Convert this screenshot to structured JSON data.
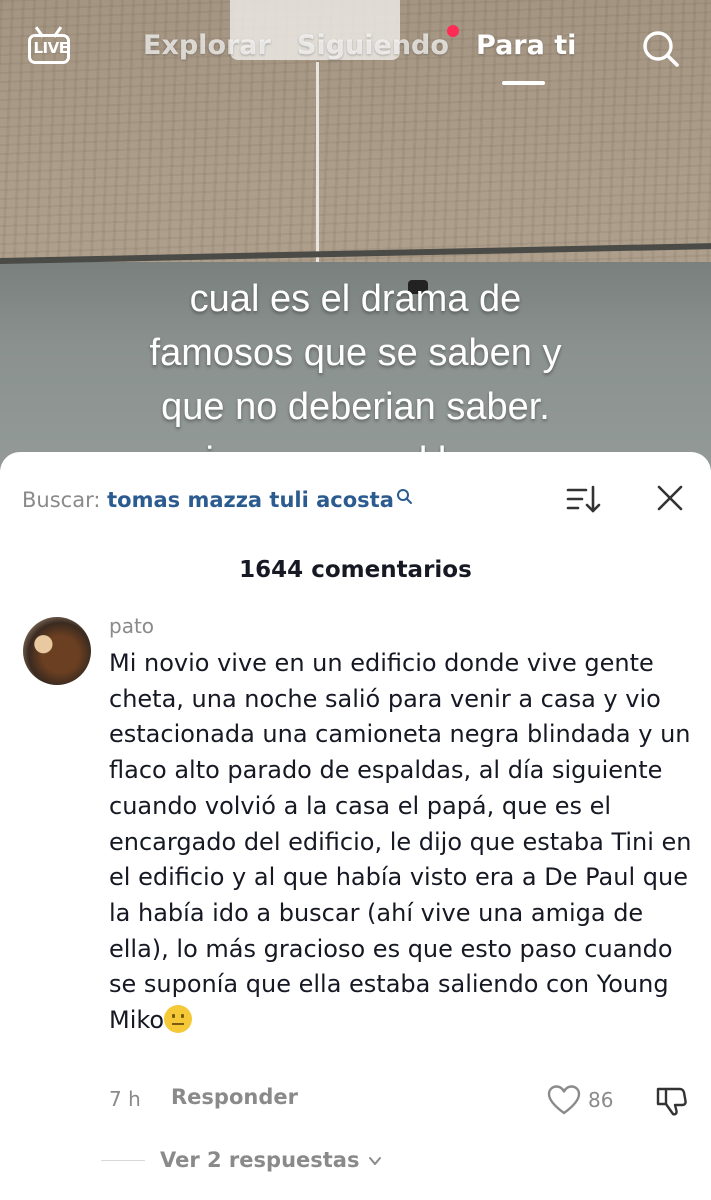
{
  "topbar": {
    "live_label": "LIVE",
    "tabs": [
      {
        "label": "Explorar",
        "active": false
      },
      {
        "label": "Siguiendo",
        "active": false,
        "badge_color": "#fe2c55"
      },
      {
        "label": "Para ti",
        "active": true
      }
    ],
    "search_icon": "search-icon"
  },
  "video": {
    "caption_lines": [
      "cual es el drama de",
      "famosos que se saben y",
      "que no deberian saber.",
      "empiezo yo: se el loco con"
    ]
  },
  "comments_sheet": {
    "search_label": "Buscar:",
    "search_query": "tomas mazza tuli acosta",
    "count_label": "1644 comentarios",
    "comment": {
      "username": "pato",
      "text": "Mi novio vive en un edificio donde vive gente cheta, una noche salió para venir a casa y vio estacionada una camioneta negra blindada y un flaco alto parado de espaldas, al día siguiente cuando volvió a la casa el papá, que es el encargado del edificio, le dijo que estaba Tini en el edificio y al que había visto era a De Paul que la había ido a buscar (ahí vive una amiga de ella), lo más gracioso es que esto paso cuando se suponía que ella estaba saliendo con Young Miko",
      "emoji": "neutral-face",
      "time": "7 h",
      "reply_label": "Responder",
      "likes": "86",
      "view_replies_label": "Ver 2 respuestas"
    }
  }
}
